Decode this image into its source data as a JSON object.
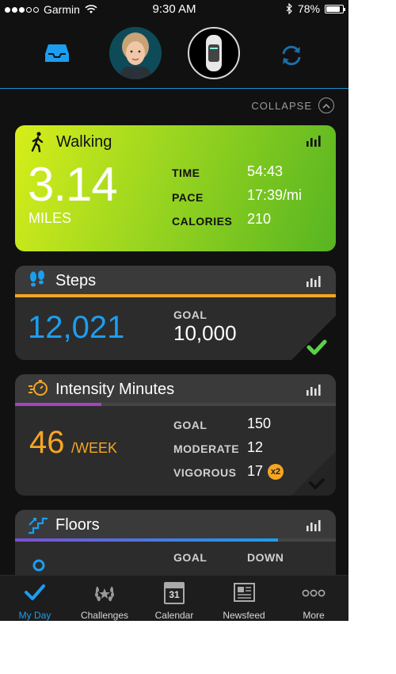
{
  "status_bar": {
    "carrier": "Garmin",
    "time": "9:30 AM",
    "battery": "78%"
  },
  "colors": {
    "accent": "#1b9ef0",
    "steps_bar": "#f5a623",
    "intensity_bar": "#a144c4",
    "floors_bar_start": "#7b4fd6",
    "floors_bar_end": "#1b9ef0"
  },
  "top_nav": {
    "icons": [
      "inbox-icon",
      "avatar",
      "device",
      "sync-icon"
    ]
  },
  "collapse_label": "COLLAPSE",
  "walking": {
    "title": "Walking",
    "distance": "3.14",
    "distance_unit": "MILES",
    "time_label": "TIME",
    "time_value": "54:43",
    "pace_label": "PACE",
    "pace_value": "17:39/mi",
    "calories_label": "CALORIES",
    "calories_value": "210"
  },
  "steps": {
    "title": "Steps",
    "value": "12,021",
    "goal_label": "GOAL",
    "goal_value": "10,000",
    "progress": 1.0,
    "completed": true
  },
  "intensity": {
    "title": "Intensity Minutes",
    "value": "46",
    "unit": "/WEEK",
    "goal_label": "GOAL",
    "goal_value": "150",
    "moderate_label": "MODERATE",
    "moderate_value": "12",
    "vigorous_label": "VIGOROUS",
    "vigorous_value": "17",
    "vigorous_badge": "x2",
    "progress": 0.27
  },
  "floors": {
    "title": "Floors",
    "goal_label": "GOAL",
    "down_label": "DOWN",
    "progress": 0.82
  },
  "tabs": [
    {
      "label": "My Day",
      "active": true
    },
    {
      "label": "Challenges",
      "active": false
    },
    {
      "label": "Calendar",
      "active": false,
      "icon_text": "31"
    },
    {
      "label": "Newsfeed",
      "active": false
    },
    {
      "label": "More",
      "active": false
    }
  ]
}
